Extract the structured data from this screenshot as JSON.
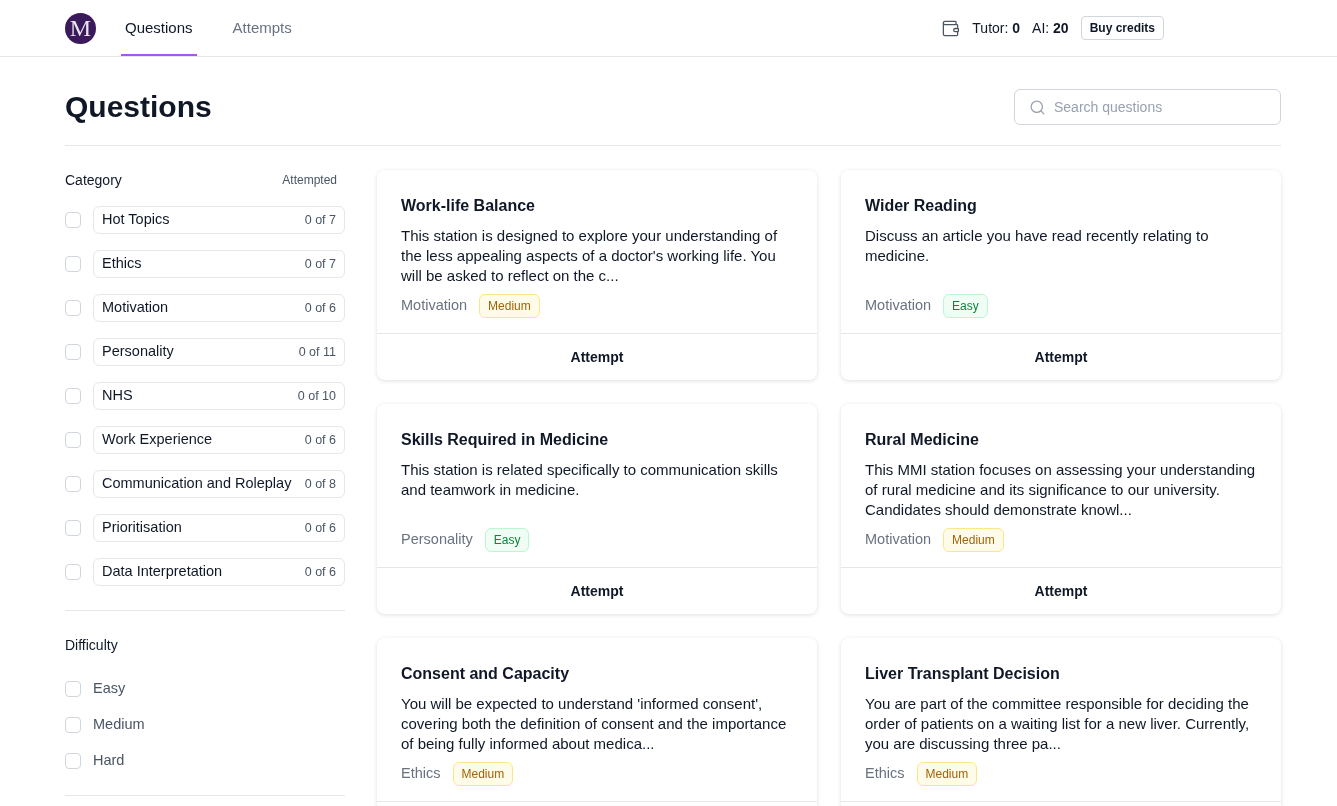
{
  "header": {
    "logo": "M",
    "nav": [
      {
        "label": "Questions",
        "selected": true
      },
      {
        "label": "Attempts",
        "selected": false
      }
    ],
    "credits": [
      "Tutor: **0**",
      "AI: **20**"
    ],
    "buy_button": "Buy credits"
  },
  "page_title": "Questions",
  "search": {
    "placeholder": "Search questions"
  },
  "filters": {
    "category": {
      "title": "Category",
      "column_label": "Attempted",
      "items": [
        {
          "label": "Hot Topics",
          "count": "0 of 7",
          "checked": false
        },
        {
          "label": "Ethics",
          "count": "0 of 7",
          "checked": false
        },
        {
          "label": "Motivation",
          "count": "0 of 6",
          "checked": false
        },
        {
          "label": "Personality",
          "count": "0 of 11",
          "checked": false
        },
        {
          "label": "NHS",
          "count": "0 of 10",
          "checked": false
        },
        {
          "label": "Work Experience",
          "count": "0 of 6",
          "checked": false
        },
        {
          "label": "Communication and Roleplay",
          "count": "0 of 8",
          "checked": false
        },
        {
          "label": "Prioritisation",
          "count": "0 of 6",
          "checked": false
        },
        {
          "label": "Data Interpretation",
          "count": "0 of 6",
          "checked": false
        }
      ]
    },
    "difficulty": {
      "title": "Difficulty",
      "items": [
        {
          "label": "Easy",
          "checked": false
        },
        {
          "label": "Medium",
          "checked": false
        },
        {
          "label": "Hard",
          "checked": false
        }
      ]
    }
  },
  "cards": [
    {
      "title": "Work-life Balance",
      "description": "This station is designed to explore your understanding of the less appealing aspects of a doctor's working life. You will be asked to reflect on the c...",
      "category": "Motivation",
      "difficulty": {
        "label": "Medium",
        "kind": "medium"
      },
      "action": "Attempt"
    },
    {
      "title": "Wider Reading",
      "description": "Discuss an article you have read recently relating to medicine.",
      "category": "Motivation",
      "difficulty": {
        "label": "Easy",
        "kind": "easy"
      },
      "action": "Attempt"
    },
    {
      "title": "Skills Required in Medicine",
      "description": "This station is related specifically to communication skills and teamwork in medicine.",
      "category": "Personality",
      "difficulty": {
        "label": "Easy",
        "kind": "easy"
      },
      "action": "Attempt"
    },
    {
      "title": "Rural Medicine",
      "description": "This MMI station focuses on assessing your understanding of rural medicine and its significance to our university. Candidates should demonstrate knowl...",
      "category": "Motivation",
      "difficulty": {
        "label": "Medium",
        "kind": "medium"
      },
      "action": "Attempt"
    },
    {
      "title": "Consent and Capacity",
      "description": "You will be expected to understand 'informed consent', covering both the definition of consent and the importance of being fully informed about medica...",
      "category": "Ethics",
      "difficulty": {
        "label": "Medium",
        "kind": "medium"
      }
    },
    {
      "title": "Liver Transplant Decision",
      "description": "You are part of the committee responsible for deciding the order of patients on a waiting list for a new liver. Currently, you are discussing three pa...",
      "category": "Ethics",
      "difficulty": {
        "label": "Medium",
        "kind": "medium"
      }
    }
  ]
}
